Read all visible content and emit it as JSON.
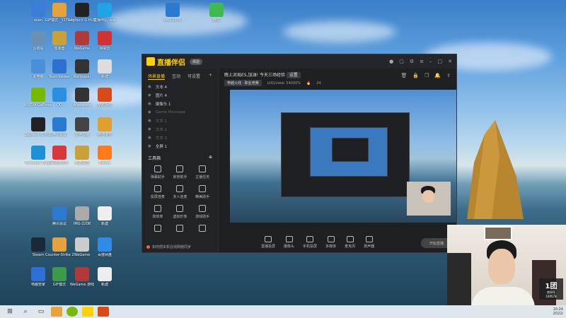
{
  "desktop_icons": [
    {
      "label": "wlan",
      "color": "#3b7dd8"
    },
    {
      "label": "GIF模式\n_1274488b",
      "color": "#e8a23c"
    },
    {
      "label": "Logitech G\nHUB",
      "color": "#222222"
    },
    {
      "label": "直播伴侣\n.exe",
      "color": "#20a4e6"
    },
    {
      "label": "IMG-1070",
      "color": "#2a7ad0"
    },
    {
      "label": "微信",
      "color": "#3dbb4f"
    },
    {
      "label": "回收站",
      "color": "#6b8fb5"
    },
    {
      "label": "加速器",
      "color": "#caa039"
    },
    {
      "label": "WeGame",
      "color": "#b03a3a"
    },
    {
      "label": "网易云",
      "color": "#d23232"
    },
    {
      "label": "此电脑",
      "color": "#4a90d9"
    },
    {
      "label": "TeamViewer",
      "color": "#2e6fd0"
    },
    {
      "label": "Wallpaper",
      "color": "#333333"
    },
    {
      "label": "新建",
      "color": "#dddddd"
    },
    {
      "label": "NVIDIA GeForce\nExperience",
      "color": "#76b900"
    },
    {
      "label": "QQ",
      "color": "#2b8fe0"
    },
    {
      "label": "Alienware",
      "color": "#333333"
    },
    {
      "label": "穿越火线",
      "color": "#d84a1a"
    },
    {
      "label": "Logitech G\nHUB",
      "color": "#222222"
    },
    {
      "label": "腾讯会议",
      "color": "#2a7ad0"
    },
    {
      "label": "雷神加速",
      "color": "#444444"
    },
    {
      "label": "绝地求生",
      "color": "#e0a030"
    },
    {
      "label": "Microsoft\nEdge",
      "color": "#1f8fd8"
    },
    {
      "label": "网易云音乐",
      "color": "#d9363e"
    },
    {
      "label": "英雄联盟",
      "color": "#caa039"
    },
    {
      "label": "Firefox",
      "color": "#ff7a1a"
    },
    {
      "label": "腾讯会议",
      "color": "#2a7ad0"
    },
    {
      "label": "IMG-2208",
      "color": "#aaaaaa"
    },
    {
      "label": "新建",
      "color": "#eeeeee"
    },
    {
      "label": "Steam",
      "color": "#1b2838"
    },
    {
      "label": "Counter-Strike\n2",
      "color": "#e8a23c"
    },
    {
      "label": "WeGame",
      "color": "#cccccc"
    },
    {
      "label": "百度网盘",
      "color": "#2f8be6"
    },
    {
      "label": "电脑管家",
      "color": "#2f6fd6"
    },
    {
      "label": "GIF模式",
      "color": "#3a9b4a"
    },
    {
      "label": "WeGame\n游戏",
      "color": "#b03a3a"
    },
    {
      "label": "新建",
      "color": "#eeeeee"
    }
  ],
  "app": {
    "logo": "直播伴侣",
    "badge": "体验",
    "side_tabs": [
      "场景直播",
      "互动",
      "可设置"
    ],
    "sources": [
      {
        "label": "文本 4",
        "dim": false
      },
      {
        "label": "图片 4",
        "dim": false
      },
      {
        "label": "摄像头 1",
        "dim": false
      },
      {
        "label": "Game Message",
        "dim": true
      },
      {
        "label": "文本 1",
        "dim": true
      },
      {
        "label": "文本 2",
        "dim": true
      },
      {
        "label": "文本 3",
        "dim": true
      },
      {
        "label": "全屏 1",
        "dim": false
      }
    ],
    "tools_title": "工具箱",
    "tools": [
      "弹幕助手",
      "房管助手",
      "主播任务",
      "投屏连麦",
      "多人连麦",
      "精美助手",
      "高效率",
      "虚拟形象",
      "游戏助手",
      "",
      "",
      ""
    ],
    "foot_text": "如何把本机在线网络同步",
    "stream_title": "晚上对局ES,加油!  今天三场经验",
    "stream_tag": "设置",
    "category": "穿越火线 · 职业竞赛",
    "stats_1": "LOG/view: 54000%",
    "stats_2": "24",
    "bottom_buttons": [
      "直播投屏",
      "摄像头",
      "手机投屏",
      "多媒体",
      "麦克风",
      "扬声器"
    ],
    "start_live": "开始直播"
  },
  "cam": {
    "badge_big": "1团",
    "badge_small": "房间号",
    "room_no": "109578"
  },
  "taskbar": {
    "time": "10:24",
    "date": "2022/"
  }
}
